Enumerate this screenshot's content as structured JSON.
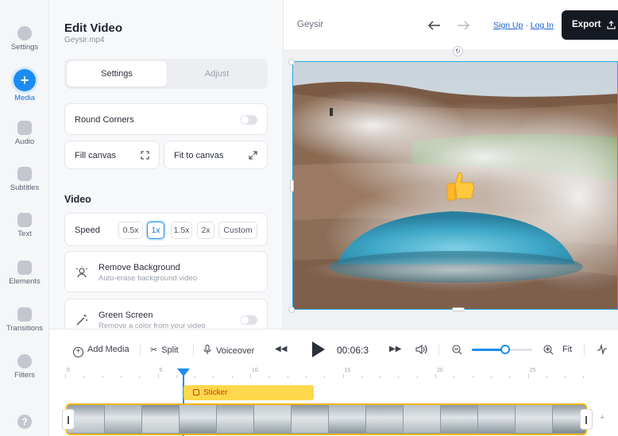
{
  "sidebar": {
    "items": [
      {
        "label": "Settings",
        "icon": "settings-icon"
      },
      {
        "label": "Media",
        "icon": "plus-icon",
        "active": true
      },
      {
        "label": "Audio",
        "icon": "music-icon"
      },
      {
        "label": "Subtitles",
        "icon": "subtitles-icon"
      },
      {
        "label": "Text",
        "icon": "text-icon"
      },
      {
        "label": "Elements",
        "icon": "elements-icon"
      },
      {
        "label": "Transitions",
        "icon": "transitions-icon"
      },
      {
        "label": "Filters",
        "icon": "filters-icon"
      }
    ],
    "help_glyph": "?",
    "plus_glyph": "+"
  },
  "panel": {
    "title": "Edit Video",
    "filename": "Geysir.mp4",
    "tabs": [
      "Settings",
      "Adjust"
    ],
    "round_corners": "Round Corners",
    "fill_canvas": "Fill canvas",
    "fit_to_canvas": "Fit to canvas",
    "video_section": "Video",
    "speed_label": "Speed",
    "speed_options": [
      "0.5x",
      "1x",
      "1.5x",
      "2x",
      "Custom"
    ],
    "speed_selected": "1x",
    "remove_bg_title": "Remove Background",
    "remove_bg_sub": "Auto-erase background video",
    "green_screen_title": "Green Screen",
    "green_screen_sub": "Remove a color from your video"
  },
  "topbar": {
    "project_name": "Geysir",
    "sign_up": "Sign Up",
    "auth_sep": " · ",
    "log_in": "Log In",
    "export_label": "Export"
  },
  "timeline": {
    "add_media": "Add Media",
    "split": "Split",
    "voiceover": "Voiceover",
    "time": "00:06:3",
    "fit": "Fit",
    "zoom_level": 0.55,
    "ruler_labels": [
      "0",
      "5",
      "10",
      "15",
      "20",
      "25"
    ],
    "sticker_label": "Sticker",
    "plus": "+"
  },
  "colors": {
    "accent": "#1a8cf2",
    "export_bg": "#151922",
    "sticker": "#ffd84d",
    "clip_border": "#f5b400",
    "selection": "#21a9e1"
  }
}
